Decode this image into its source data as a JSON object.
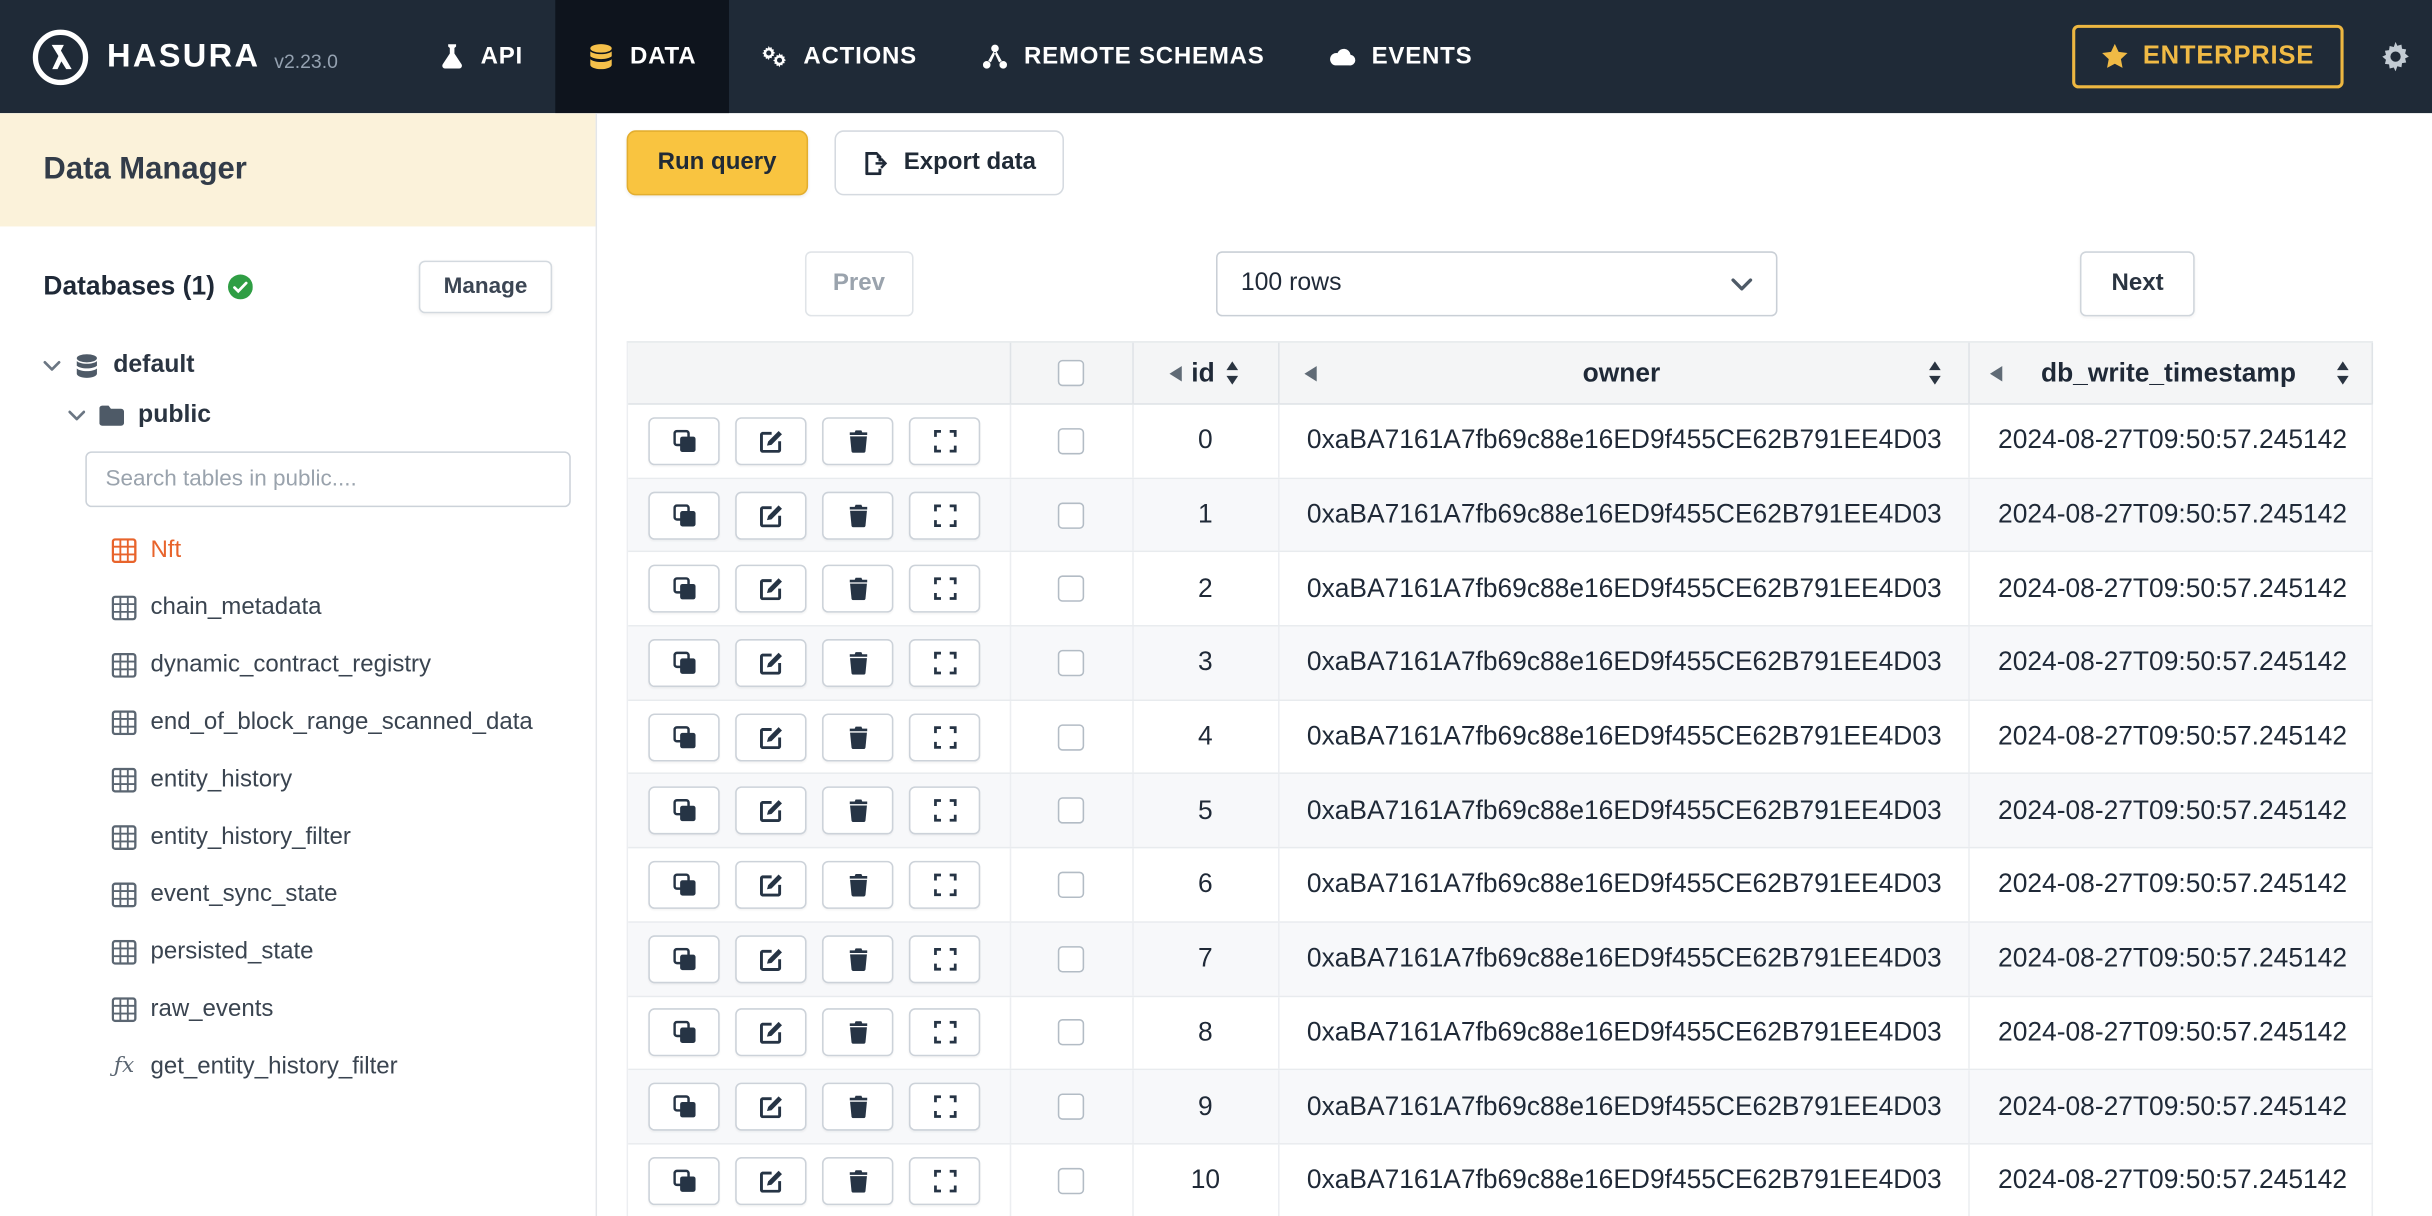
{
  "colors": {
    "navbar_bg": "#1f2a37",
    "accent_yellow": "#f9c440",
    "active_table_orange": "#e8642c",
    "verified_green": "#2f9e44"
  },
  "navbar": {
    "brand": "HASURA",
    "version": "v2.23.0",
    "items": [
      {
        "label": "API",
        "icon": "flask-icon",
        "active": false
      },
      {
        "label": "DATA",
        "icon": "database-icon",
        "active": true
      },
      {
        "label": "ACTIONS",
        "icon": "gears-icon",
        "active": false
      },
      {
        "label": "REMOTE SCHEMAS",
        "icon": "schema-icon",
        "active": false
      },
      {
        "label": "EVENTS",
        "icon": "cloud-icon",
        "active": false
      }
    ],
    "enterprise_label": "ENTERPRISE"
  },
  "sidebar": {
    "title": "Data Manager",
    "databases_label": "Databases (1)",
    "manage_button": "Manage",
    "tree": {
      "database": "default",
      "schema": "public",
      "search_placeholder": "Search tables in public....",
      "tables": [
        {
          "label": "Nft",
          "type": "table",
          "active": true
        },
        {
          "label": "chain_metadata",
          "type": "table",
          "active": false
        },
        {
          "label": "dynamic_contract_registry",
          "type": "table",
          "active": false
        },
        {
          "label": "end_of_block_range_scanned_data",
          "type": "table",
          "active": false
        },
        {
          "label": "entity_history",
          "type": "table",
          "active": false
        },
        {
          "label": "entity_history_filter",
          "type": "table",
          "active": false
        },
        {
          "label": "event_sync_state",
          "type": "table",
          "active": false
        },
        {
          "label": "persisted_state",
          "type": "table",
          "active": false
        },
        {
          "label": "raw_events",
          "type": "table",
          "active": false
        },
        {
          "label": "get_entity_history_filter",
          "type": "function",
          "active": false
        }
      ]
    }
  },
  "toolbar": {
    "run_query": "Run query",
    "export_data": "Export data"
  },
  "pagination": {
    "prev": "Prev",
    "rows_per_page": "100 rows",
    "next": "Next"
  },
  "table": {
    "columns": [
      "id",
      "owner",
      "db_write_timestamp"
    ],
    "rows": [
      {
        "id": "0",
        "owner": "0xaBA7161A7fb69c88e16ED9f455CE62B791EE4D03",
        "db_write_timestamp": "2024-08-27T09:50:57.245142"
      },
      {
        "id": "1",
        "owner": "0xaBA7161A7fb69c88e16ED9f455CE62B791EE4D03",
        "db_write_timestamp": "2024-08-27T09:50:57.245142"
      },
      {
        "id": "2",
        "owner": "0xaBA7161A7fb69c88e16ED9f455CE62B791EE4D03",
        "db_write_timestamp": "2024-08-27T09:50:57.245142"
      },
      {
        "id": "3",
        "owner": "0xaBA7161A7fb69c88e16ED9f455CE62B791EE4D03",
        "db_write_timestamp": "2024-08-27T09:50:57.245142"
      },
      {
        "id": "4",
        "owner": "0xaBA7161A7fb69c88e16ED9f455CE62B791EE4D03",
        "db_write_timestamp": "2024-08-27T09:50:57.245142"
      },
      {
        "id": "5",
        "owner": "0xaBA7161A7fb69c88e16ED9f455CE62B791EE4D03",
        "db_write_timestamp": "2024-08-27T09:50:57.245142"
      },
      {
        "id": "6",
        "owner": "0xaBA7161A7fb69c88e16ED9f455CE62B791EE4D03",
        "db_write_timestamp": "2024-08-27T09:50:57.245142"
      },
      {
        "id": "7",
        "owner": "0xaBA7161A7fb69c88e16ED9f455CE62B791EE4D03",
        "db_write_timestamp": "2024-08-27T09:50:57.245142"
      },
      {
        "id": "8",
        "owner": "0xaBA7161A7fb69c88e16ED9f455CE62B791EE4D03",
        "db_write_timestamp": "2024-08-27T09:50:57.245142"
      },
      {
        "id": "9",
        "owner": "0xaBA7161A7fb69c88e16ED9f455CE62B791EE4D03",
        "db_write_timestamp": "2024-08-27T09:50:57.245142"
      },
      {
        "id": "10",
        "owner": "0xaBA7161A7fb69c88e16ED9f455CE62B791EE4D03",
        "db_write_timestamp": "2024-08-27T09:50:57.245142"
      }
    ]
  }
}
